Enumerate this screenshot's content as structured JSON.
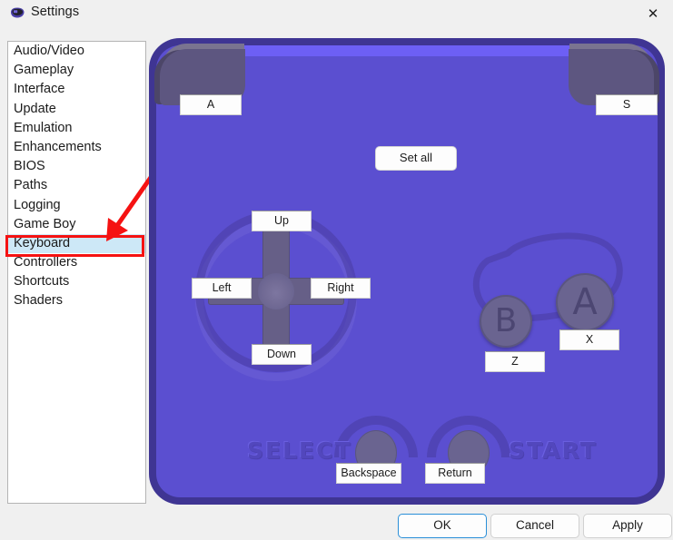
{
  "window": {
    "title": "Settings",
    "icon": "gameboy-icon",
    "close_label": "✕"
  },
  "sidebar": {
    "items": [
      {
        "label": "Audio/Video",
        "selected": false
      },
      {
        "label": "Gameplay",
        "selected": false
      },
      {
        "label": "Interface",
        "selected": false
      },
      {
        "label": "Update",
        "selected": false
      },
      {
        "label": "Emulation",
        "selected": false
      },
      {
        "label": "Enhancements",
        "selected": false
      },
      {
        "label": "BIOS",
        "selected": false
      },
      {
        "label": "Paths",
        "selected": false
      },
      {
        "label": "Logging",
        "selected": false
      },
      {
        "label": "Game Boy",
        "selected": false
      },
      {
        "label": "Keyboard",
        "selected": true
      },
      {
        "label": "Controllers",
        "selected": false
      },
      {
        "label": "Shortcuts",
        "selected": false
      },
      {
        "label": "Shaders",
        "selected": false
      }
    ]
  },
  "annotation": {
    "highlight_color": "#f51212",
    "target": "Keyboard"
  },
  "gamepad": {
    "set_all_label": "Set all",
    "shoulder_left_key": "A",
    "shoulder_right_key": "S",
    "dpad": {
      "up": "Up",
      "down": "Down",
      "left": "Left",
      "right": "Right"
    },
    "face_buttons": {
      "a_glyph": "A",
      "a_key": "X",
      "b_glyph": "B",
      "b_key": "Z"
    },
    "system_buttons": {
      "select_label": "SELECT",
      "select_key": "Backspace",
      "start_label": "START",
      "start_key": "Return"
    },
    "colors": {
      "body": "#5b4fd0",
      "body_border": "#3f3593",
      "body_highlight": "#6d5ff5",
      "button": "#6a6490",
      "shoulder": "#5d5680"
    }
  },
  "dialog_buttons": {
    "ok": "OK",
    "cancel": "Cancel",
    "apply": "Apply"
  }
}
